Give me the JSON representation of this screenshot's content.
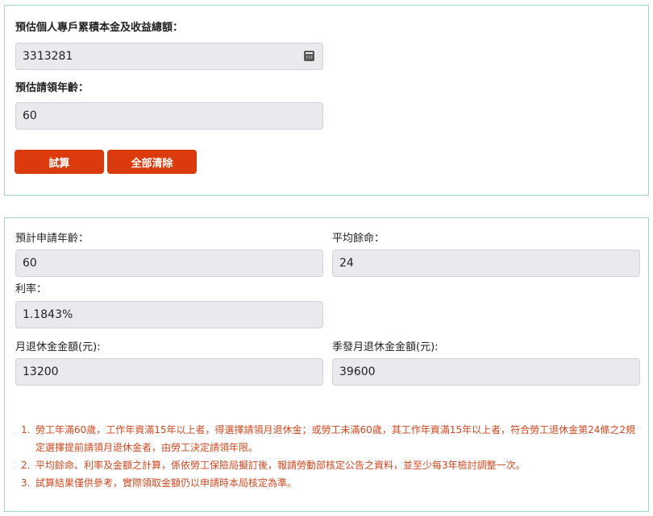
{
  "input_panel": {
    "total_label": "預估個人專戶累積本金及收益總額：",
    "total_value": "3313281",
    "age_label": "預估請領年齡：",
    "age_value": "60",
    "calc_button": "試算",
    "clear_button": "全部清除"
  },
  "result_panel": {
    "apply_age_label": "預計申請年齡：",
    "apply_age_value": "60",
    "life_label": "平均餘命：",
    "life_value": "24",
    "rate_label": "利率：",
    "rate_value": "1.1843%",
    "monthly_label": "月退休金金額(元):",
    "monthly_value": "13200",
    "quarterly_label": "季發月退休金金額(元):",
    "quarterly_value": "39600"
  },
  "notes": [
    {
      "num": "1.",
      "text": "勞工年滿60歲，工作年資滿15年以上者，得選擇請領月退休金；或勞工未滿60歲，其工作年資滿15年以上者，符合勞工退休金第24條之2規定選擇提前請領月退休金者，由勞工決定請領年限。"
    },
    {
      "num": "2.",
      "text": "平均餘命、利率及金額之計算，係依勞工保險局擬訂後，報請勞動部核定公告之資料，並至少每3年檢討調整一次。"
    },
    {
      "num": "3.",
      "text": "試算結果僅供參考，實際領取金額仍以申請時本局核定為準。"
    }
  ],
  "colors": {
    "accent": "#db3b0c",
    "note_text": "#d0481f",
    "panel_border": "#9fd6c9",
    "field_bg": "#e9eaee"
  },
  "icons": {
    "total_field_icon": "calculator-icon"
  }
}
